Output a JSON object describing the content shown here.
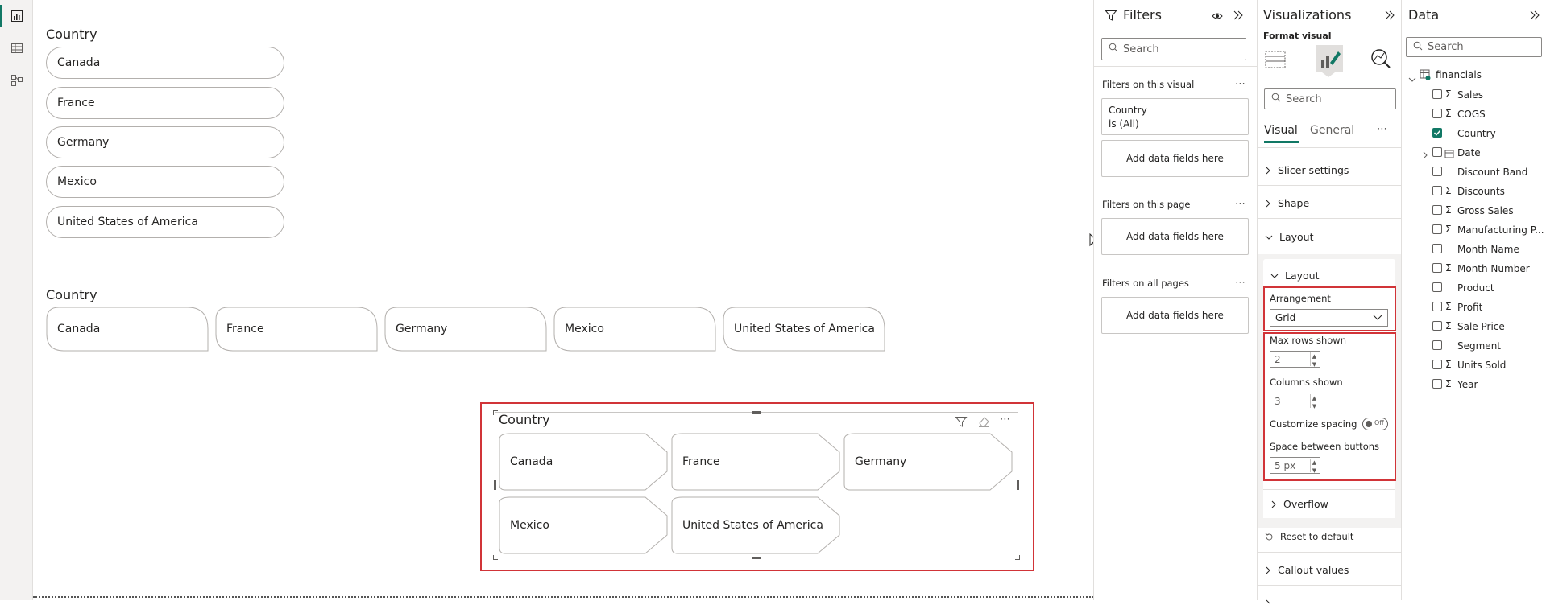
{
  "canvas": {
    "slicer1": {
      "title": "Country",
      "items": [
        "Canada",
        "France",
        "Germany",
        "Mexico",
        "United States of America"
      ]
    },
    "slicer2": {
      "title": "Country",
      "items": [
        "Canada",
        "France",
        "Germany",
        "Mexico",
        "United States of America"
      ]
    },
    "slicer3": {
      "title": "Country",
      "items": [
        "Canada",
        "France",
        "Germany",
        "Mexico",
        "United States of America"
      ]
    }
  },
  "filters": {
    "title": "Filters",
    "search_placeholder": "Search",
    "on_visual_label": "Filters on this visual",
    "visual_filter_field": "Country",
    "visual_filter_value": "is (All)",
    "add_fields": "Add data fields here",
    "on_page_label": "Filters on this page",
    "all_pages_label": "Filters on all pages"
  },
  "viz": {
    "title": "Visualizations",
    "subtitle": "Format visual",
    "search_placeholder": "Search",
    "tab_visual": "Visual",
    "tab_general": "General",
    "sections": {
      "slicer_settings": "Slicer settings",
      "shape": "Shape",
      "layout": "Layout",
      "layout_inner": "Layout",
      "overflow": "Overflow",
      "callout_values": "Callout values"
    },
    "arrangement_label": "Arrangement",
    "arrangement_value": "Grid",
    "max_rows_label": "Max rows shown",
    "max_rows_value": "2",
    "columns_label": "Columns shown",
    "columns_value": "3",
    "customize_spacing_label": "Customize spacing",
    "customize_spacing_toggle": "Off",
    "space_between_label": "Space between buttons",
    "space_between_value": "5 px",
    "reset_label": "Reset to default"
  },
  "data": {
    "title": "Data",
    "search_placeholder": "Search",
    "table_name": "financials",
    "fields": [
      {
        "name": "Sales",
        "sigma": true,
        "checked": false
      },
      {
        "name": "COGS",
        "sigma": true,
        "checked": false
      },
      {
        "name": "Country",
        "sigma": false,
        "checked": true
      },
      {
        "name": "Date",
        "sigma": false,
        "checked": false
      },
      {
        "name": "Discount Band",
        "sigma": false,
        "checked": false
      },
      {
        "name": "Discounts",
        "sigma": true,
        "checked": false
      },
      {
        "name": "Gross Sales",
        "sigma": true,
        "checked": false
      },
      {
        "name": "Manufacturing P...",
        "sigma": true,
        "checked": false
      },
      {
        "name": "Month Name",
        "sigma": false,
        "checked": false
      },
      {
        "name": "Month Number",
        "sigma": true,
        "checked": false
      },
      {
        "name": "Product",
        "sigma": false,
        "checked": false
      },
      {
        "name": "Profit",
        "sigma": true,
        "checked": false
      },
      {
        "name": "Sale Price",
        "sigma": true,
        "checked": false
      },
      {
        "name": "Segment",
        "sigma": false,
        "checked": false
      },
      {
        "name": "Units Sold",
        "sigma": true,
        "checked": false
      },
      {
        "name": "Year",
        "sigma": true,
        "checked": false
      }
    ]
  },
  "colors": {
    "accent": "#117865",
    "highlight": "#d13438"
  }
}
